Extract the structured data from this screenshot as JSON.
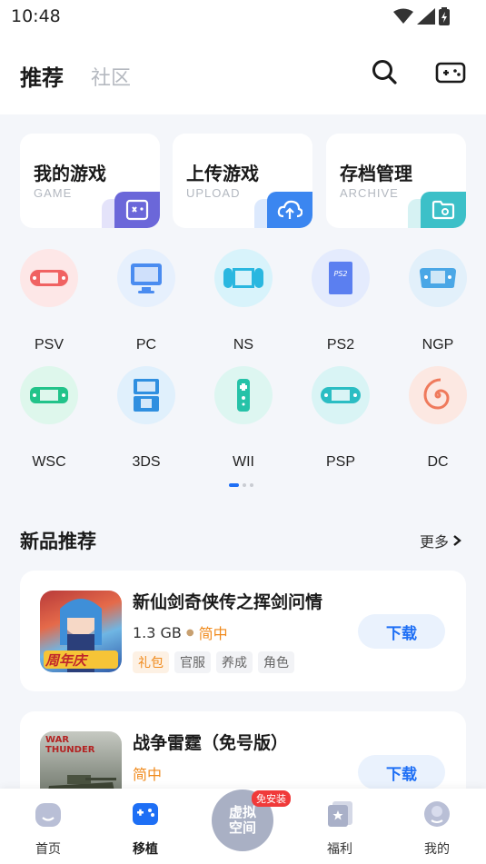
{
  "status": {
    "time": "10:48"
  },
  "header": {
    "tab_recommend": "推荐",
    "tab_community": "社区"
  },
  "quick_cards": [
    {
      "title": "我的游戏",
      "sub": "GAME",
      "icon": "game-card-icon",
      "color": "#6b67d9"
    },
    {
      "title": "上传游戏",
      "sub": "UPLOAD",
      "icon": "cloud-upload-icon",
      "color": "#3b86f0"
    },
    {
      "title": "存档管理",
      "sub": "ARCHIVE",
      "icon": "folder-icon",
      "color": "#3cc0c8"
    }
  ],
  "platforms_row1": [
    "PSV",
    "PC",
    "NS",
    "PS2",
    "NGP"
  ],
  "platforms_row2": [
    "WSC",
    "3DS",
    "WII",
    "PSP",
    "DC"
  ],
  "section": {
    "title": "新品推荐",
    "more": "更多"
  },
  "games": [
    {
      "name": "新仙剑奇侠传之挥剑问情",
      "size": "1.3 GB",
      "lang": "简中",
      "tags": [
        "礼包",
        "官服",
        "养成",
        "角色"
      ],
      "download": "下载",
      "thumb_text": "周年庆"
    },
    {
      "name": "战争雷霆（免号版）",
      "size": "",
      "lang": "简中",
      "tags": [],
      "download": "下载",
      "thumb_text": "WAR THUNDER"
    }
  ],
  "bottom_nav": {
    "home": "首页",
    "port": "移植",
    "center_line1": "虚拟",
    "center_line2": "空间",
    "center_badge": "免安装",
    "welfare": "福利",
    "mine": "我的"
  },
  "colors": {
    "accent": "#1e6ff5",
    "orange": "#f08a1c",
    "badge_red": "#f03a3a"
  }
}
